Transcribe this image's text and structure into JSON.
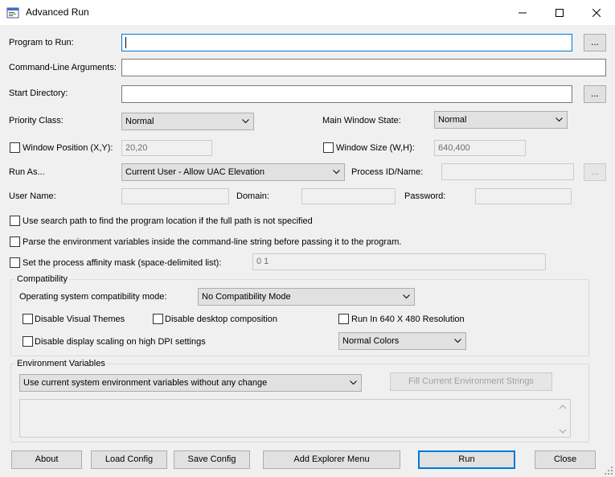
{
  "window": {
    "title": "Advanced Run",
    "icon": "app-window-icon"
  },
  "fields": {
    "program_label": "Program to Run:",
    "program_value": "",
    "args_label": "Command-Line Arguments:",
    "args_value": "",
    "startdir_label": "Start Directory:",
    "startdir_value": "",
    "browse_label": "...",
    "priority_label": "Priority Class:",
    "priority_value": "Normal",
    "mainwin_label": "Main Window State:",
    "mainwin_value": "Normal",
    "winpos_label": "Window Position (X,Y):",
    "winpos_value": "20,20",
    "winsize_label": "Window Size (W,H):",
    "winsize_value": "640,400",
    "runas_label": "Run As...",
    "runas_value": "Current User - Allow UAC Elevation",
    "pid_label": "Process ID/Name:",
    "pid_value": "",
    "username_label": "User Name:",
    "domain_label": "Domain:",
    "password_label": "Password:"
  },
  "options": {
    "search_path": "Use search path to find the program location if the full path is not specified",
    "parse_env": "Parse the environment variables inside the command-line string before passing it to the program.",
    "affinity": "Set the process affinity mask (space-delimited list):",
    "affinity_value": "0 1"
  },
  "compat": {
    "title": "Compatibility",
    "os_mode_label": "Operating system compatibility mode:",
    "os_mode_value": "No Compatibility Mode",
    "disable_visual": "Disable Visual Themes",
    "disable_desktop": "Disable desktop composition",
    "run_640": "Run In 640 X 480 Resolution",
    "disable_dpi": "Disable display scaling on high DPI settings",
    "colors_value": "Normal Colors"
  },
  "env": {
    "title": "Environment Variables",
    "mode_value": "Use current system environment variables without any change",
    "fill_button": "Fill Current Environment Strings"
  },
  "buttons": {
    "about": "About",
    "load": "Load Config",
    "save": "Save Config",
    "explorer": "Add Explorer Menu",
    "run": "Run",
    "close": "Close"
  },
  "colors": {
    "accent": "#0078d7",
    "window_bg": "#f0f0f0"
  }
}
